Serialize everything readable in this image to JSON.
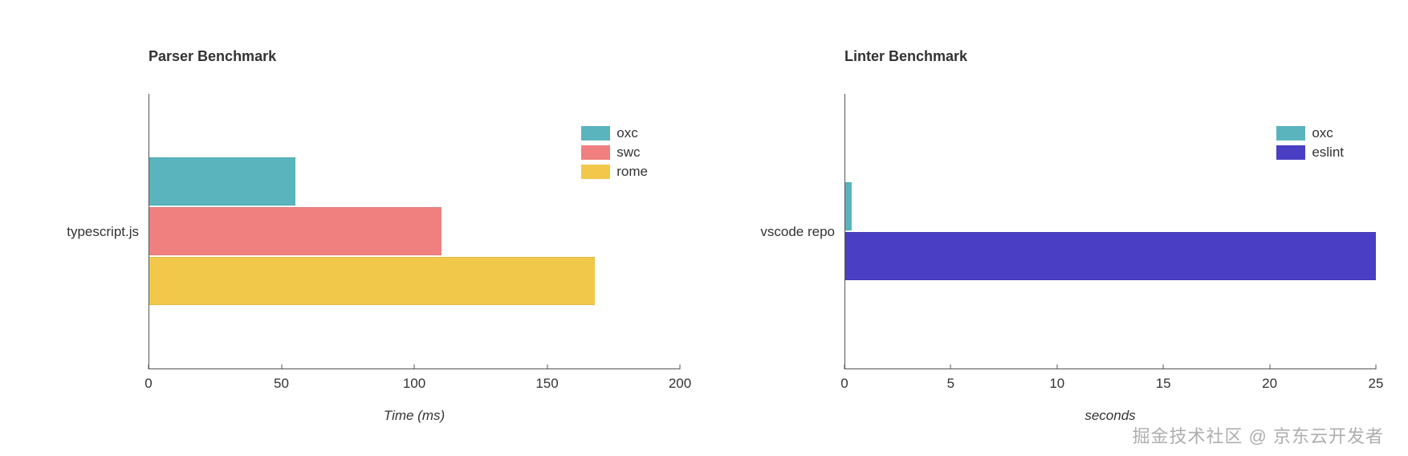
{
  "chart_data": [
    {
      "type": "bar",
      "orientation": "horizontal",
      "title": "Parser Benchmark",
      "xlabel": "Time (ms)",
      "ylabel": "",
      "categories": [
        "typescript.js"
      ],
      "series": [
        {
          "name": "oxc",
          "values": [
            55
          ],
          "color": "#5ab4bd"
        },
        {
          "name": "swc",
          "values": [
            110
          ],
          "color": "#f08080"
        },
        {
          "name": "rome",
          "values": [
            168
          ],
          "color": "#f2c84b"
        }
      ],
      "xlim": [
        0,
        200
      ],
      "xticks": [
        0,
        50,
        100,
        150,
        200
      ]
    },
    {
      "type": "bar",
      "orientation": "horizontal",
      "title": "Linter Benchmark",
      "xlabel": "seconds",
      "ylabel": "",
      "categories": [
        "vscode repo"
      ],
      "series": [
        {
          "name": "oxc",
          "values": [
            0.3
          ],
          "color": "#5ab4bd"
        },
        {
          "name": "eslint",
          "values": [
            25
          ],
          "color": "#4a3fc4"
        }
      ],
      "xlim": [
        0,
        25
      ],
      "xticks": [
        0,
        5,
        10,
        15,
        20,
        25
      ]
    }
  ],
  "watermark": "掘金技术社区 @ 京东云开发者"
}
